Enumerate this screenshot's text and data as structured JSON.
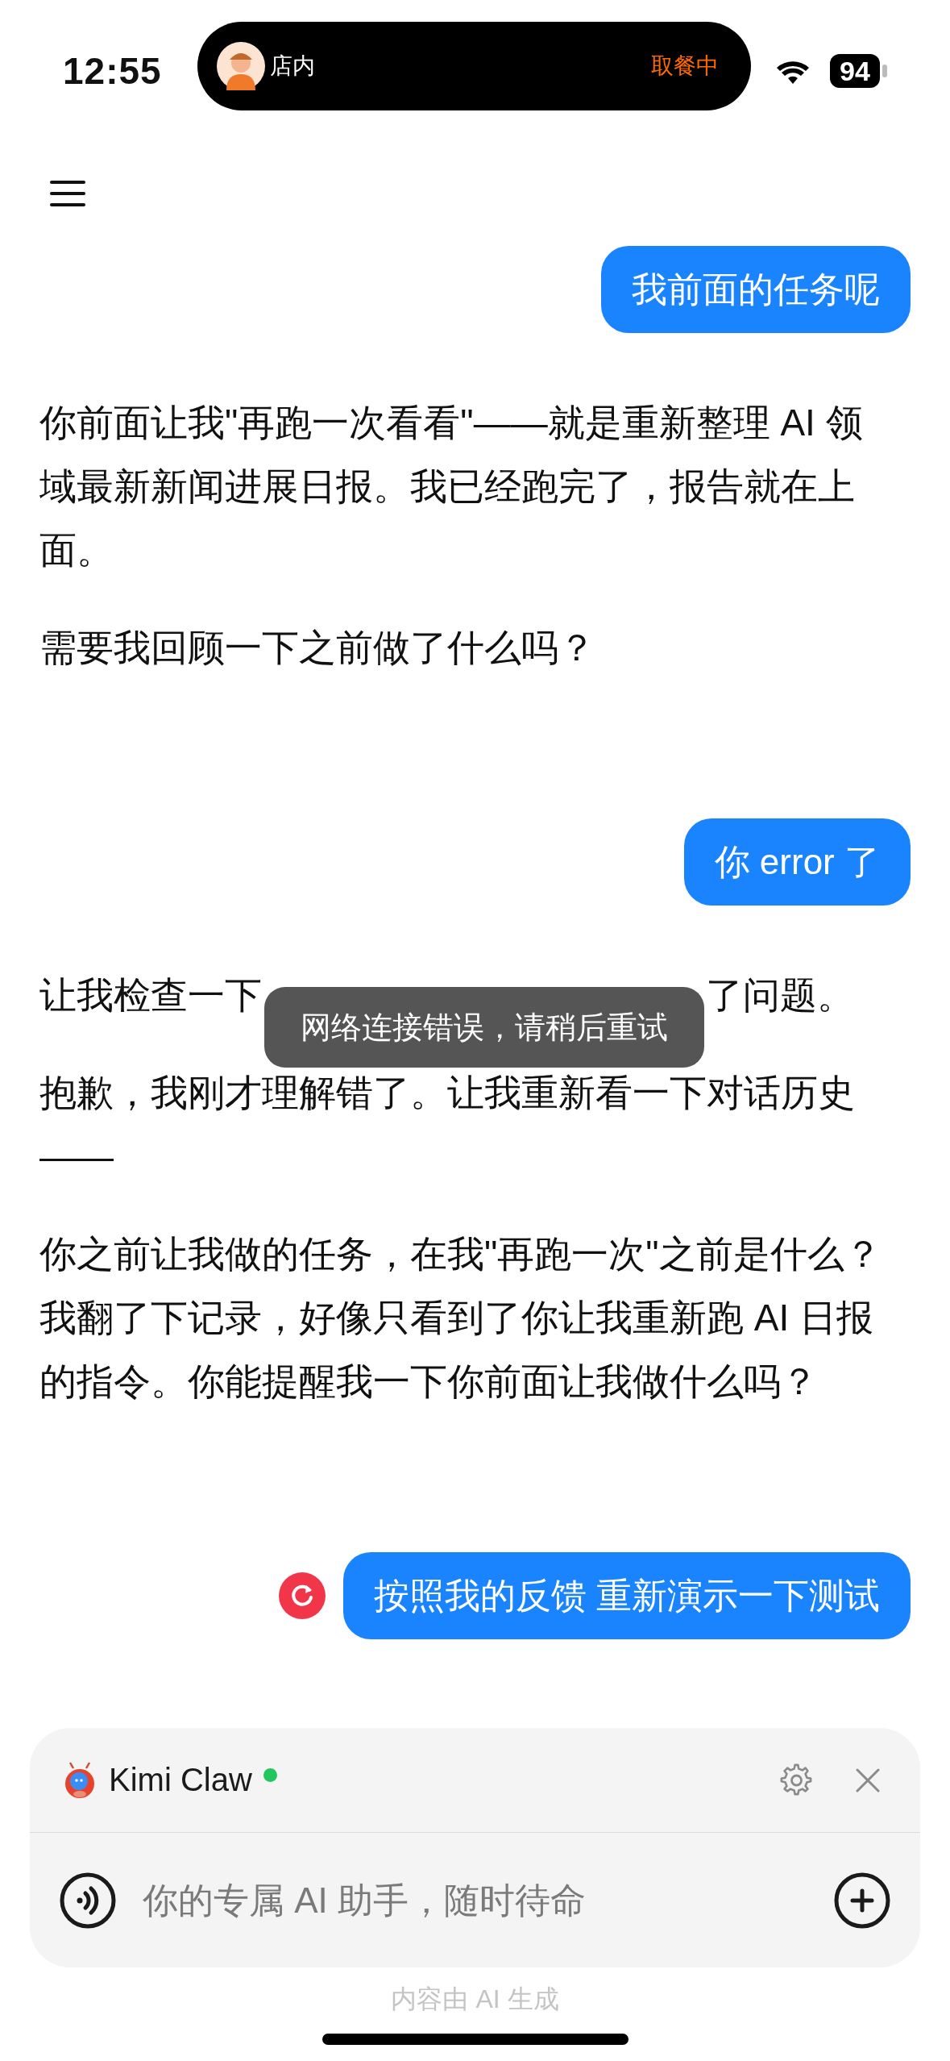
{
  "status_bar": {
    "time": "12:55",
    "activity": {
      "label": "店内",
      "status": "取餐中"
    },
    "battery": "94"
  },
  "messages": [
    {
      "kind": "user",
      "text": "我前面的任务呢",
      "failed": false
    },
    {
      "kind": "assistant",
      "paragraphs": [
        {
          "kind": "text",
          "text": "你前面让我\"再跑一次看看\"——就是重新整理 AI 领域最新新闻进展日报。我已经跑完了，报告就在上面。"
        },
        {
          "kind": "text",
          "text": "需要我回顾一下之前做了什么吗？"
        }
      ]
    },
    {
      "kind": "user",
      "text": "你 error 了",
      "failed": false
    },
    {
      "kind": "assistant",
      "paragraphs": [
        {
          "kind": "covered",
          "parts": [
            "让我检查一下",
            "了问题。"
          ]
        },
        {
          "kind": "text",
          "text": "抱歉，我刚才理解错了。让我重新看一下对话历史——"
        },
        {
          "kind": "text",
          "text": "你之前让我做的任务，在我\"再跑一次\"之前是什么？我翻了下记录，好像只看到了你让我重新跑 AI 日报的指令。你能提醒我一下你前面让我做什么吗？"
        }
      ]
    },
    {
      "kind": "user",
      "text": "按照我的反馈 重新演示一下测试",
      "failed": true
    }
  ],
  "toast": {
    "text": "网络连接错误，请稍后重试"
  },
  "composer": {
    "assistant_name": "Kimi Claw",
    "online": true,
    "placeholder": "你的专属 AI 助手，随时待命"
  },
  "footer_note": "内容由 AI 生成"
}
